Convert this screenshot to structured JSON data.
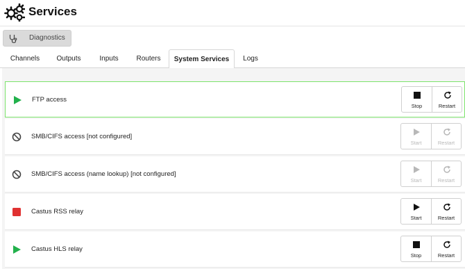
{
  "header": {
    "title": "Services",
    "icon": "gears-icon"
  },
  "diagnostics": {
    "label": "Diagnostics",
    "icon": "stethoscope-icon"
  },
  "tabs": [
    {
      "label": "Channels",
      "active": false
    },
    {
      "label": "Outputs",
      "active": false
    },
    {
      "label": "Inputs",
      "active": false
    },
    {
      "label": "Routers",
      "active": false
    },
    {
      "label": "System Services",
      "active": true
    },
    {
      "label": "Logs",
      "active": false
    }
  ],
  "services": [
    {
      "name": "FTP access",
      "status": "running",
      "selected": true,
      "actions": [
        {
          "label": "Stop",
          "icon": "stop-icon",
          "enabled": true
        },
        {
          "label": "Restart",
          "icon": "restart-icon",
          "enabled": true
        }
      ]
    },
    {
      "name": "SMB/CIFS access [not configured]",
      "status": "not-configured",
      "selected": false,
      "actions": [
        {
          "label": "Start",
          "icon": "play-icon",
          "enabled": false
        },
        {
          "label": "Restart",
          "icon": "restart-icon",
          "enabled": false
        }
      ]
    },
    {
      "name": "SMB/CIFS access (name lookup) [not configured]",
      "status": "not-configured",
      "selected": false,
      "actions": [
        {
          "label": "Start",
          "icon": "play-icon",
          "enabled": false
        },
        {
          "label": "Restart",
          "icon": "restart-icon",
          "enabled": false
        }
      ]
    },
    {
      "name": "Castus RSS relay",
      "status": "stopped",
      "selected": false,
      "actions": [
        {
          "label": "Start",
          "icon": "play-icon",
          "enabled": true
        },
        {
          "label": "Restart",
          "icon": "restart-icon",
          "enabled": true
        }
      ]
    },
    {
      "name": "Castus HLS relay",
      "status": "running",
      "selected": false,
      "actions": [
        {
          "label": "Stop",
          "icon": "stop-icon",
          "enabled": true
        },
        {
          "label": "Restart",
          "icon": "restart-icon",
          "enabled": true
        }
      ]
    }
  ],
  "colors": {
    "running": "#22b14c",
    "stopped": "#e03131",
    "selected_border": "#7be36a",
    "disabled": "#b8b8b8"
  }
}
